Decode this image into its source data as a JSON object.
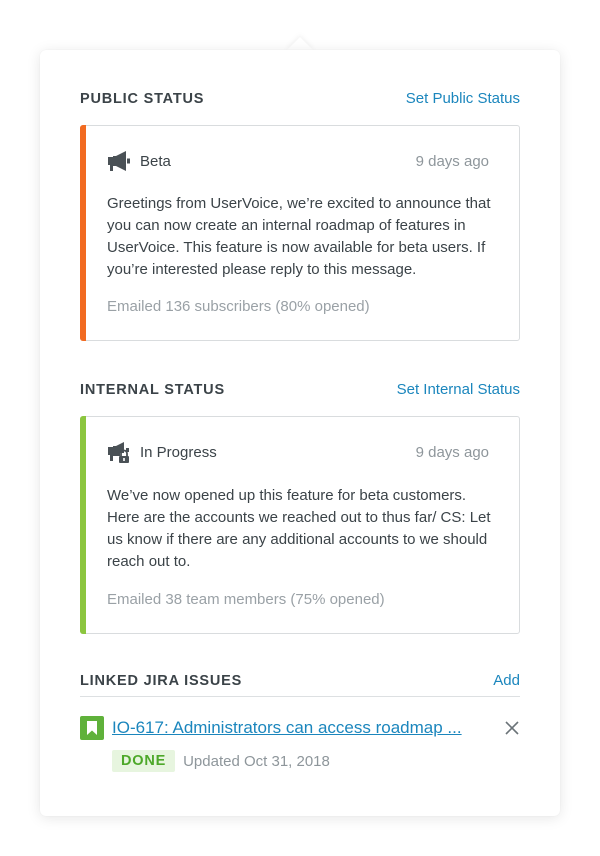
{
  "public_status": {
    "title": "PUBLIC STATUS",
    "action_label": "Set Public Status",
    "accent_color": "#f26b21",
    "status": "Beta",
    "time": "9 days ago",
    "message": "Greetings from UserVoice, we’re excited to announce that you can now create an internal roadmap of features in UserVoice. This feature is now available for beta users. If you’re interested please reply to this message.",
    "meta": "Emailed 136 subscribers (80% opened)",
    "icon": "megaphone-icon"
  },
  "internal_status": {
    "title": "INTERNAL STATUS",
    "action_label": "Set Internal Status",
    "accent_color": "#8cc63f",
    "status": "In Progress",
    "time": "9 days ago",
    "message": "We’ve now opened up this feature for beta customers. Here are the accounts we reached out to thus far/ CS: Let us know if there are any additional accounts to we should reach out to.",
    "meta": "Emailed 38 team members (75% opened)",
    "icon": "megaphone-lock-icon"
  },
  "jira": {
    "title": "LINKED JIRA ISSUES",
    "action_label": "Add",
    "issues": [
      {
        "title": "IO-617: Administrators can access roadmap ...",
        "status": "DONE",
        "updated": "Updated Oct 31, 2018",
        "icon": "bookmark-icon",
        "icon_color": "#5fb13a"
      }
    ]
  }
}
